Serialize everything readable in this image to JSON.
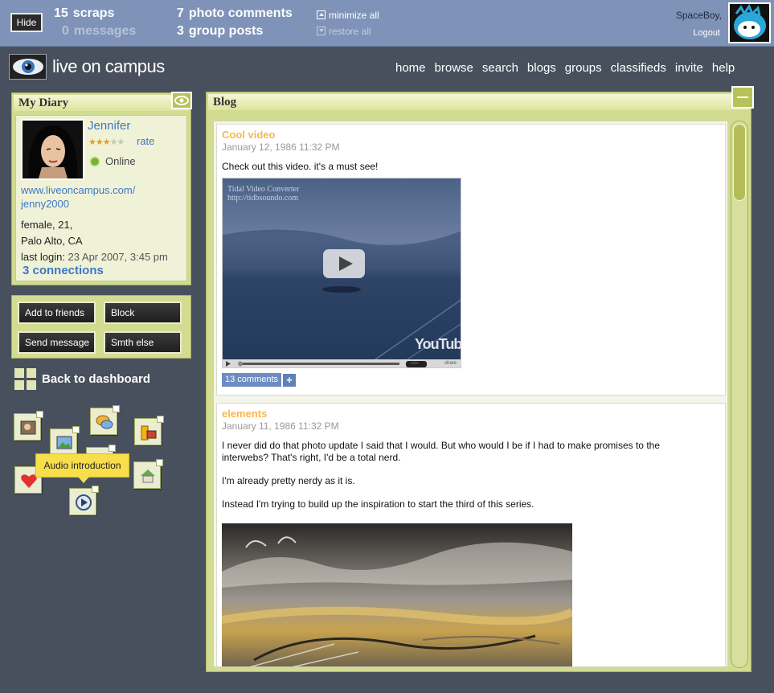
{
  "topbar": {
    "hide_label": "Hide",
    "scraps_count": "15",
    "scraps_label": "scraps",
    "messages_count": "0",
    "messages_label": "messages",
    "photo_comments_count": "7",
    "photo_comments_label": "photo comments",
    "group_posts_count": "3",
    "group_posts_label": "group posts",
    "minimize_all": "minimize all",
    "restore_all": "restore all",
    "username": "SpaceBoy,",
    "logout": "Logout"
  },
  "header": {
    "logo_text": "live on campus",
    "nav": [
      "home",
      "browse",
      "search",
      "blogs",
      "groups",
      "classifieds",
      "invite",
      "help"
    ]
  },
  "diary": {
    "title": "My Diary",
    "name": "Jennifer",
    "rating": 3,
    "rating_max": 5,
    "rate_label": "rate",
    "status": "Online",
    "url_line1": "www.liveoncampus.com/",
    "url_line2": "jenny2000",
    "info_line1": "female, 21,",
    "info_line2": "Palo Alto, CA",
    "last_login_label": "last login:",
    "last_login_value": "23 Apr 2007, 3:45 pm",
    "connections": "3 connections"
  },
  "actions": {
    "add_friends": "Add to friends",
    "block": "Block",
    "send_message": "Send message",
    "something_else": "Smth else"
  },
  "dashboard": {
    "back_label": "Back to dashboard",
    "tooltip": "Audio introduction"
  },
  "blog": {
    "title": "Blog",
    "posts": [
      {
        "title": "Cool video",
        "date": "January 12, 1986  11:32 PM",
        "text": "Check out this video. it's a must see!",
        "comments": "13 comments",
        "video_overlay": "Tidal Video Converter",
        "video_url": "http://tidbsoundo.com",
        "video_brand": "YouTube",
        "video_time": "--:--",
        "video_share": "share"
      },
      {
        "title": "elements",
        "date": "January 11, 1986  11:32 PM",
        "para1": "I never did do that photo update I said that I would. But who would I be if I had to make promises to the interwebs? That's right, I'd be a total nerd.",
        "para2": "I'm already pretty nerdy as it is.",
        "para3": "Instead I'm trying to build up the inspiration to start the third of this series."
      }
    ]
  },
  "colors": {
    "background": "#48505d",
    "topbar": "#7f93b8",
    "panel": "#d2dc91",
    "link": "#3d78c5",
    "post_title": "#f7b84d",
    "tooltip": "#f7de4a"
  },
  "icons": [
    "eye-icon",
    "photo-icon",
    "chat-icon",
    "folder-icon",
    "heart-icon",
    "house-icon",
    "play-icon",
    "dashboard-grid-icon"
  ]
}
